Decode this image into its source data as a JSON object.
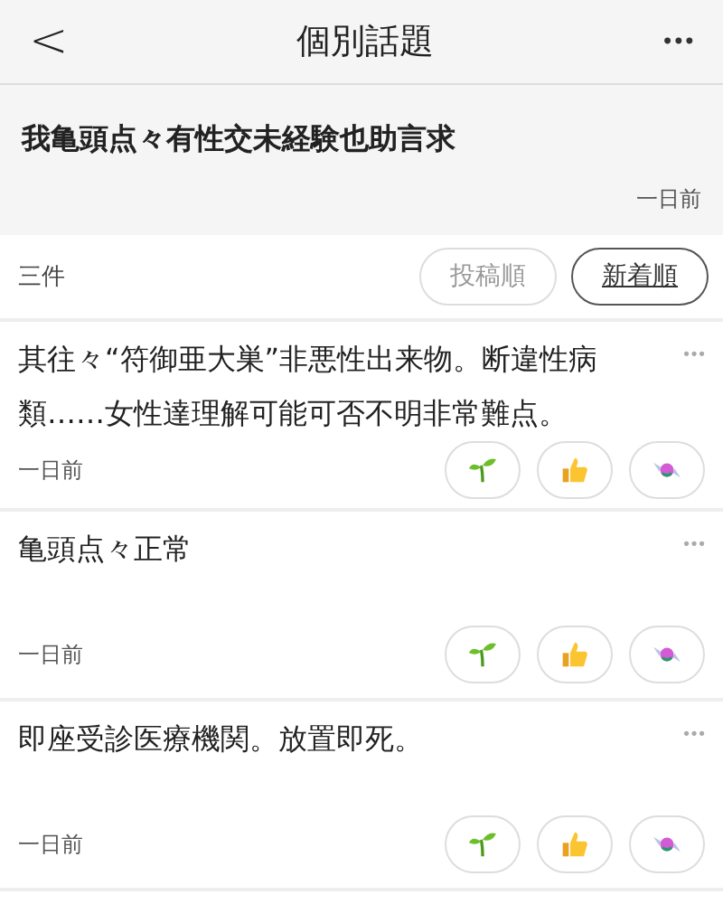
{
  "header": {
    "back": "<",
    "title": "個別話題",
    "more": "•••"
  },
  "topic": {
    "text": "我亀頭点々有性交未経験也助言求",
    "time": "一日前"
  },
  "sort_bar": {
    "count": "三件",
    "options": [
      {
        "label": "投稿順",
        "selected": false
      },
      {
        "label": "新着順",
        "selected": true
      }
    ]
  },
  "comments": [
    {
      "text": "其往々“符御亜大巣”非悪性出来物。断違性病類……女性達理解可能可否不明非常難点。",
      "time": "一日前",
      "more": "•••"
    },
    {
      "text": "亀頭点々正常",
      "time": "一日前",
      "more": "•••"
    },
    {
      "text": "即座受診医療機関。放置即死。",
      "time": "一日前",
      "more": "•••"
    }
  ]
}
